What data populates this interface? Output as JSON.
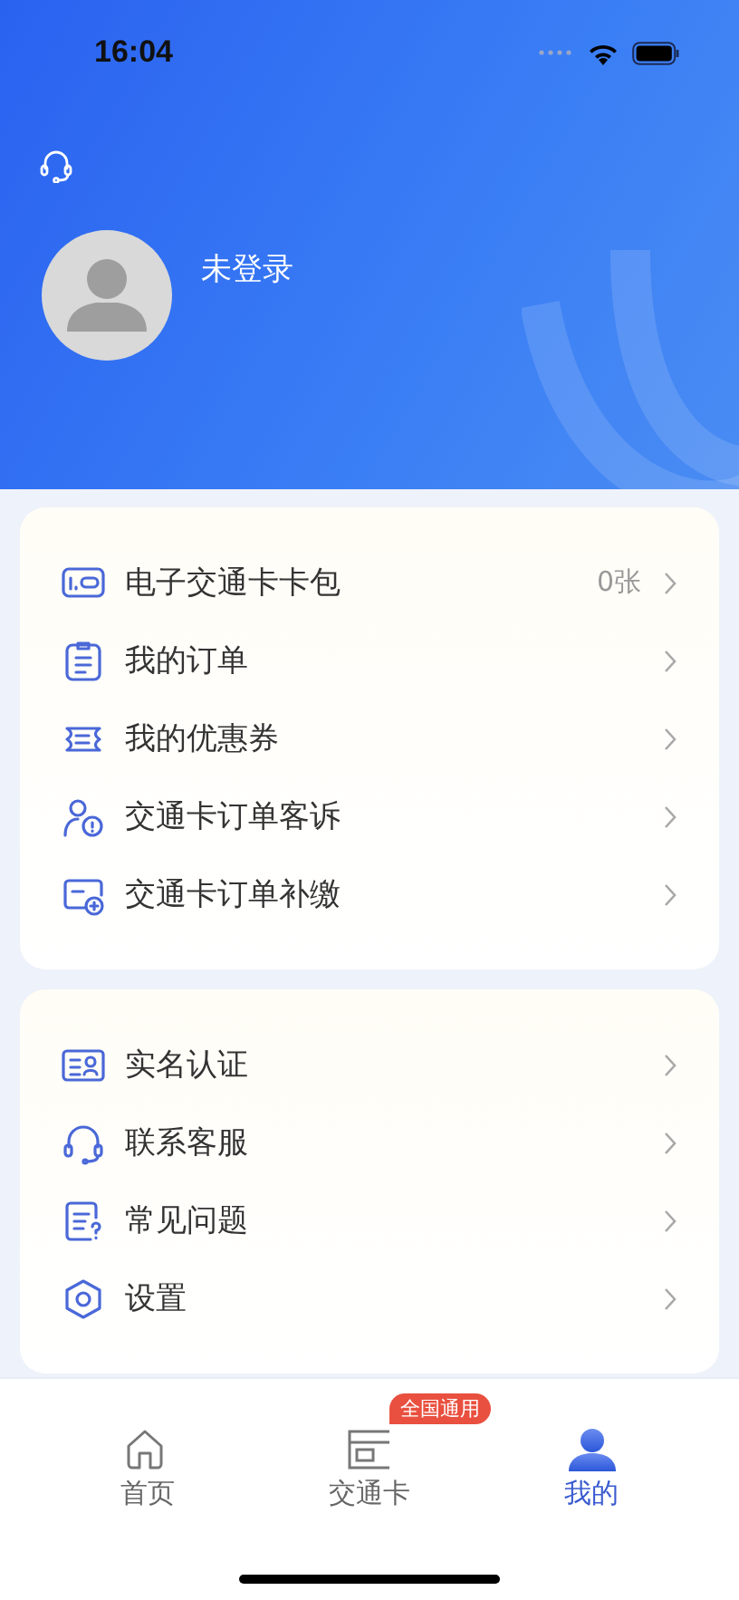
{
  "status_bar": {
    "time": "16:04"
  },
  "profile": {
    "name": "未登录"
  },
  "menu_groups": [
    {
      "items": [
        {
          "kind": "card-wallet",
          "label": "电子交通卡卡包",
          "value": "0张"
        },
        {
          "kind": "order",
          "label": "我的订单"
        },
        {
          "kind": "coupon",
          "label": "我的优惠券"
        },
        {
          "kind": "complaint",
          "label": "交通卡订单客诉"
        },
        {
          "kind": "payment",
          "label": "交通卡订单补缴"
        }
      ]
    },
    {
      "items": [
        {
          "kind": "realname",
          "label": "实名认证"
        },
        {
          "kind": "service",
          "label": "联系客服"
        },
        {
          "kind": "faq",
          "label": "常见问题"
        },
        {
          "kind": "settings",
          "label": "设置"
        }
      ]
    }
  ],
  "tab_bar": {
    "tabs": [
      {
        "kind": "home",
        "label": "首页",
        "selected": false
      },
      {
        "kind": "card",
        "label": "交通卡",
        "selected": false,
        "badge": "全国通用"
      },
      {
        "kind": "me",
        "label": "我的",
        "selected": true
      }
    ]
  }
}
